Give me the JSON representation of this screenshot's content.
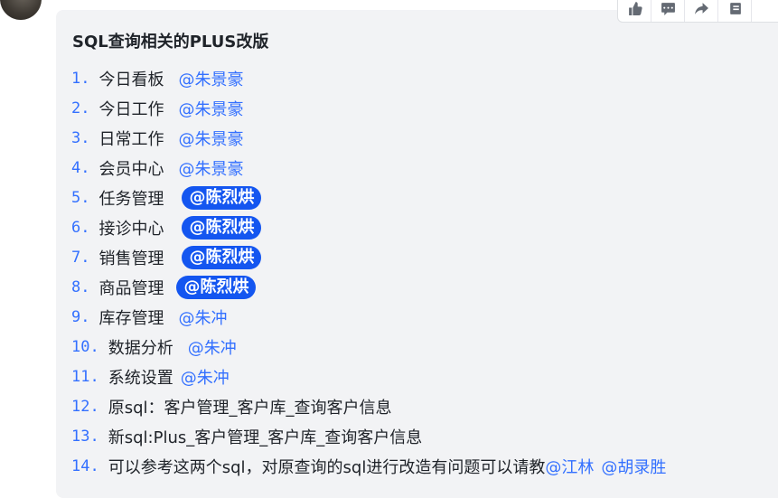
{
  "message": {
    "title": "SQL查询相关的PLUS改版",
    "items": [
      {
        "num": "1.",
        "text": "今日看板",
        "mentions": [
          "@朱景豪"
        ],
        "highlight": false
      },
      {
        "num": "2.",
        "text": "今日工作",
        "mentions": [
          "@朱景豪"
        ],
        "highlight": false
      },
      {
        "num": "3.",
        "text": "日常工作",
        "mentions": [
          "@朱景豪"
        ],
        "highlight": false
      },
      {
        "num": "4.",
        "text": "会员中心",
        "mentions": [
          "@朱景豪"
        ],
        "highlight": false
      },
      {
        "num": "5.",
        "text": "任务管理",
        "mentions": [
          "@陈烈烘"
        ],
        "highlight": true
      },
      {
        "num": "6.",
        "text": "接诊中心",
        "mentions": [
          "@陈烈烘"
        ],
        "highlight": true
      },
      {
        "num": "7.",
        "text": "销售管理",
        "mentions": [
          "@陈烈烘"
        ],
        "highlight": true
      },
      {
        "num": "8.",
        "text": "商品管理",
        "mentions": [
          "@陈烈烘"
        ],
        "highlight": true
      },
      {
        "num": "9.",
        "text": "库存管理",
        "mentions": [
          "@朱冲"
        ],
        "highlight": false
      },
      {
        "num": "10.",
        "text": "数据分析",
        "mentions": [
          "@朱冲"
        ],
        "highlight": false
      },
      {
        "num": "11.",
        "text": "系统设置",
        "mentions": [
          "@朱冲"
        ],
        "highlight": false
      },
      {
        "num": "12.",
        "text": "原sql：客户管理_客户库_查询客户信息",
        "mentions": [],
        "highlight": false
      },
      {
        "num": "13.",
        "text": "新sql:Plus_客户管理_客户库_查询客户信息",
        "mentions": [],
        "highlight": false
      },
      {
        "num": "14.",
        "text": "可以参考这两个sql，对原查询的sql进行改造有问题可以请教",
        "mentions": [
          "@江林",
          "@胡录胜"
        ],
        "highlight": false
      }
    ]
  },
  "toolbar": {
    "icons": [
      "thumbs-up-icon",
      "comment-icon",
      "forward-icon",
      "more-icon"
    ]
  },
  "colors": {
    "accent": "#3370ff",
    "self_mention_bg": "#1456f0",
    "bubble_bg": "#f2f3f5"
  }
}
